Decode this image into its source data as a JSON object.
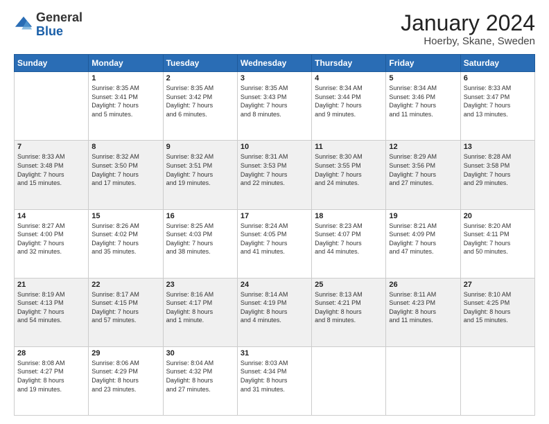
{
  "header": {
    "logo_general": "General",
    "logo_blue": "Blue",
    "month_title": "January 2024",
    "location": "Hoerby, Skane, Sweden"
  },
  "days_of_week": [
    "Sunday",
    "Monday",
    "Tuesday",
    "Wednesday",
    "Thursday",
    "Friday",
    "Saturday"
  ],
  "weeks": [
    [
      {
        "day": "",
        "info": ""
      },
      {
        "day": "1",
        "info": "Sunrise: 8:35 AM\nSunset: 3:41 PM\nDaylight: 7 hours\nand 5 minutes."
      },
      {
        "day": "2",
        "info": "Sunrise: 8:35 AM\nSunset: 3:42 PM\nDaylight: 7 hours\nand 6 minutes."
      },
      {
        "day": "3",
        "info": "Sunrise: 8:35 AM\nSunset: 3:43 PM\nDaylight: 7 hours\nand 8 minutes."
      },
      {
        "day": "4",
        "info": "Sunrise: 8:34 AM\nSunset: 3:44 PM\nDaylight: 7 hours\nand 9 minutes."
      },
      {
        "day": "5",
        "info": "Sunrise: 8:34 AM\nSunset: 3:46 PM\nDaylight: 7 hours\nand 11 minutes."
      },
      {
        "day": "6",
        "info": "Sunrise: 8:33 AM\nSunset: 3:47 PM\nDaylight: 7 hours\nand 13 minutes."
      }
    ],
    [
      {
        "day": "7",
        "info": "Sunrise: 8:33 AM\nSunset: 3:48 PM\nDaylight: 7 hours\nand 15 minutes."
      },
      {
        "day": "8",
        "info": "Sunrise: 8:32 AM\nSunset: 3:50 PM\nDaylight: 7 hours\nand 17 minutes."
      },
      {
        "day": "9",
        "info": "Sunrise: 8:32 AM\nSunset: 3:51 PM\nDaylight: 7 hours\nand 19 minutes."
      },
      {
        "day": "10",
        "info": "Sunrise: 8:31 AM\nSunset: 3:53 PM\nDaylight: 7 hours\nand 22 minutes."
      },
      {
        "day": "11",
        "info": "Sunrise: 8:30 AM\nSunset: 3:55 PM\nDaylight: 7 hours\nand 24 minutes."
      },
      {
        "day": "12",
        "info": "Sunrise: 8:29 AM\nSunset: 3:56 PM\nDaylight: 7 hours\nand 27 minutes."
      },
      {
        "day": "13",
        "info": "Sunrise: 8:28 AM\nSunset: 3:58 PM\nDaylight: 7 hours\nand 29 minutes."
      }
    ],
    [
      {
        "day": "14",
        "info": "Sunrise: 8:27 AM\nSunset: 4:00 PM\nDaylight: 7 hours\nand 32 minutes."
      },
      {
        "day": "15",
        "info": "Sunrise: 8:26 AM\nSunset: 4:02 PM\nDaylight: 7 hours\nand 35 minutes."
      },
      {
        "day": "16",
        "info": "Sunrise: 8:25 AM\nSunset: 4:03 PM\nDaylight: 7 hours\nand 38 minutes."
      },
      {
        "day": "17",
        "info": "Sunrise: 8:24 AM\nSunset: 4:05 PM\nDaylight: 7 hours\nand 41 minutes."
      },
      {
        "day": "18",
        "info": "Sunrise: 8:23 AM\nSunset: 4:07 PM\nDaylight: 7 hours\nand 44 minutes."
      },
      {
        "day": "19",
        "info": "Sunrise: 8:21 AM\nSunset: 4:09 PM\nDaylight: 7 hours\nand 47 minutes."
      },
      {
        "day": "20",
        "info": "Sunrise: 8:20 AM\nSunset: 4:11 PM\nDaylight: 7 hours\nand 50 minutes."
      }
    ],
    [
      {
        "day": "21",
        "info": "Sunrise: 8:19 AM\nSunset: 4:13 PM\nDaylight: 7 hours\nand 54 minutes."
      },
      {
        "day": "22",
        "info": "Sunrise: 8:17 AM\nSunset: 4:15 PM\nDaylight: 7 hours\nand 57 minutes."
      },
      {
        "day": "23",
        "info": "Sunrise: 8:16 AM\nSunset: 4:17 PM\nDaylight: 8 hours\nand 1 minute."
      },
      {
        "day": "24",
        "info": "Sunrise: 8:14 AM\nSunset: 4:19 PM\nDaylight: 8 hours\nand 4 minutes."
      },
      {
        "day": "25",
        "info": "Sunrise: 8:13 AM\nSunset: 4:21 PM\nDaylight: 8 hours\nand 8 minutes."
      },
      {
        "day": "26",
        "info": "Sunrise: 8:11 AM\nSunset: 4:23 PM\nDaylight: 8 hours\nand 11 minutes."
      },
      {
        "day": "27",
        "info": "Sunrise: 8:10 AM\nSunset: 4:25 PM\nDaylight: 8 hours\nand 15 minutes."
      }
    ],
    [
      {
        "day": "28",
        "info": "Sunrise: 8:08 AM\nSunset: 4:27 PM\nDaylight: 8 hours\nand 19 minutes."
      },
      {
        "day": "29",
        "info": "Sunrise: 8:06 AM\nSunset: 4:29 PM\nDaylight: 8 hours\nand 23 minutes."
      },
      {
        "day": "30",
        "info": "Sunrise: 8:04 AM\nSunset: 4:32 PM\nDaylight: 8 hours\nand 27 minutes."
      },
      {
        "day": "31",
        "info": "Sunrise: 8:03 AM\nSunset: 4:34 PM\nDaylight: 8 hours\nand 31 minutes."
      },
      {
        "day": "",
        "info": ""
      },
      {
        "day": "",
        "info": ""
      },
      {
        "day": "",
        "info": ""
      }
    ]
  ]
}
